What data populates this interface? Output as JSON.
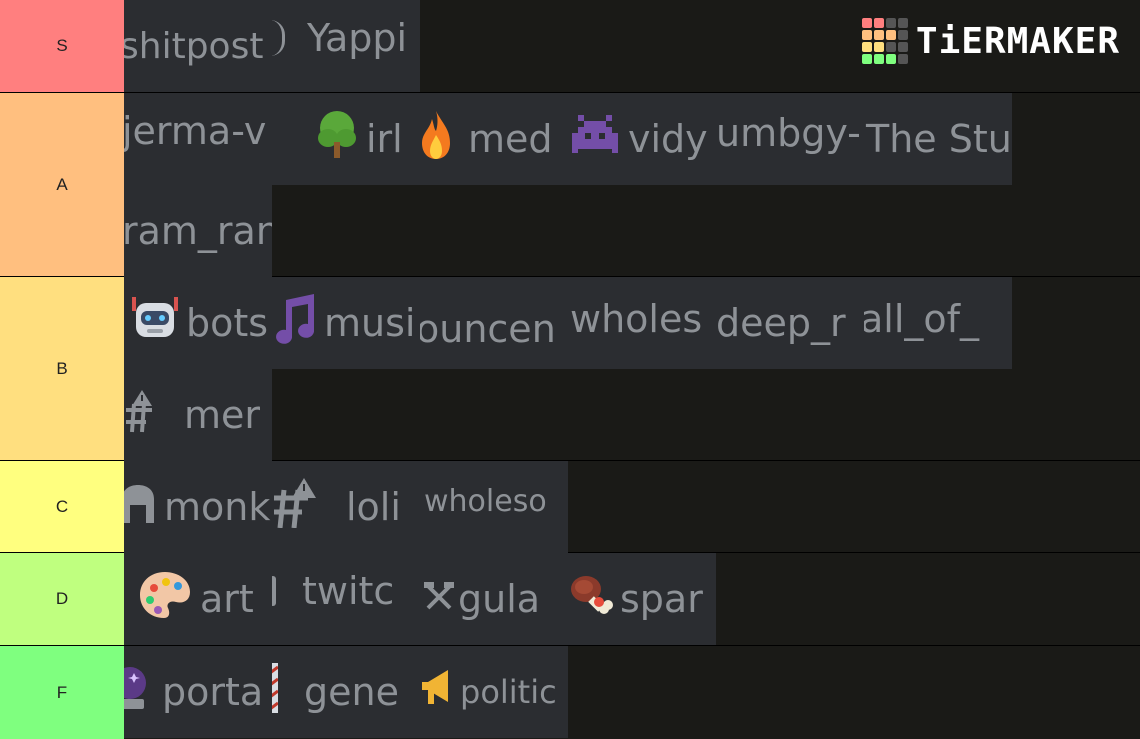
{
  "logo": {
    "text": "TiERMAKER"
  },
  "tiers": [
    {
      "label": "S",
      "color": "#ff7f7f",
      "items": [
        "shitpost",
        "Yappi"
      ]
    },
    {
      "label": "A",
      "color": "#ffbf7f",
      "items": [
        "jerma-v",
        "irl",
        "med",
        "vidy",
        "umbgy-",
        "The Stu",
        "ram_ran"
      ]
    },
    {
      "label": "B",
      "color": "#ffdf7f",
      "items": [
        "bots",
        "musi",
        "ouncen",
        "wholes",
        "deep_r",
        "all_of_",
        "mer"
      ]
    },
    {
      "label": "C",
      "color": "#ffff7f",
      "items": [
        "monk",
        "loli",
        "wholeso"
      ]
    },
    {
      "label": "D",
      "color": "#bfff7f",
      "items": [
        "art",
        "twitc",
        "gula",
        "spar"
      ]
    },
    {
      "label": "F",
      "color": "#7fff7f",
      "items": [
        "porta",
        "gene",
        "politic"
      ]
    }
  ]
}
